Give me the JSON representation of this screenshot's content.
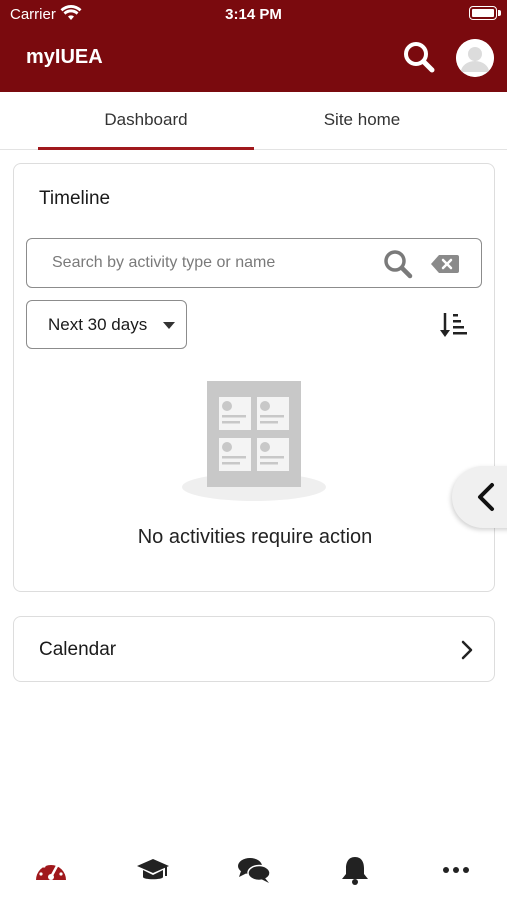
{
  "status_bar": {
    "carrier": "Carrier",
    "time": "3:14 PM"
  },
  "header": {
    "app_title": "myIUEA",
    "background_color": "#7a0a0e"
  },
  "tabs": [
    {
      "label": "Dashboard",
      "active": true
    },
    {
      "label": "Site home",
      "active": false
    }
  ],
  "timeline": {
    "title": "Timeline",
    "search": {
      "placeholder": "Search by activity type or name",
      "value": ""
    },
    "filter_selected": "Next 30 days",
    "empty_message": "No activities require action"
  },
  "calendar": {
    "label": "Calendar"
  },
  "bottom_nav": {
    "items": [
      "dashboard-gauge-icon",
      "courses-graduation-cap-icon",
      "messages-chat-icon",
      "notifications-bell-icon",
      "more-ellipsis-icon"
    ],
    "active_color": "#a0181c"
  }
}
